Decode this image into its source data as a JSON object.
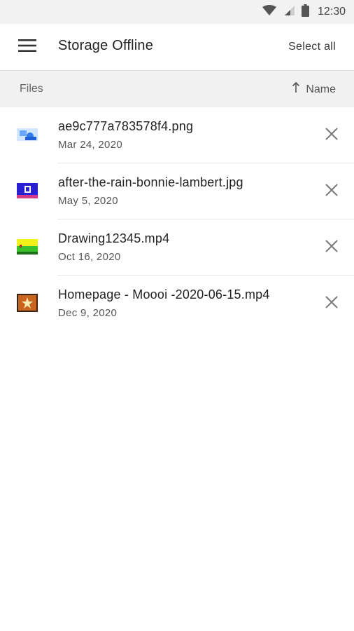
{
  "status_bar": {
    "time": "12:30",
    "icons": [
      "wifi-icon",
      "cell-signal-icon",
      "battery-icon"
    ]
  },
  "app_bar": {
    "menu_icon": "hamburger-menu-icon",
    "title": "Storage Offline",
    "select_all_label": "Select all"
  },
  "list_header": {
    "section_label": "Files",
    "sort_icon": "arrow-up-icon",
    "sort_label": "Name"
  },
  "files": [
    {
      "name": "ae9c777a783578f4.png",
      "date": "Mar 24, 2020",
      "remove_icon": "close-icon"
    },
    {
      "name": "after-the-rain-bonnie-lambert.jpg",
      "date": "May 5, 2020",
      "remove_icon": "close-icon"
    },
    {
      "name": "Drawing12345.mp4",
      "date": "Oct 16, 2020",
      "remove_icon": "close-icon"
    },
    {
      "name": "Homepage - Moooi -2020-06-15.mp4",
      "date": "Dec 9, 2020",
      "remove_icon": "close-icon"
    }
  ],
  "colors": {
    "status_bar_bg": "#f2f2f2",
    "header_bg": "#f1f1f1",
    "text_primary": "#222222",
    "text_secondary": "#555555",
    "icon_gray": "#7a7a7a"
  }
}
